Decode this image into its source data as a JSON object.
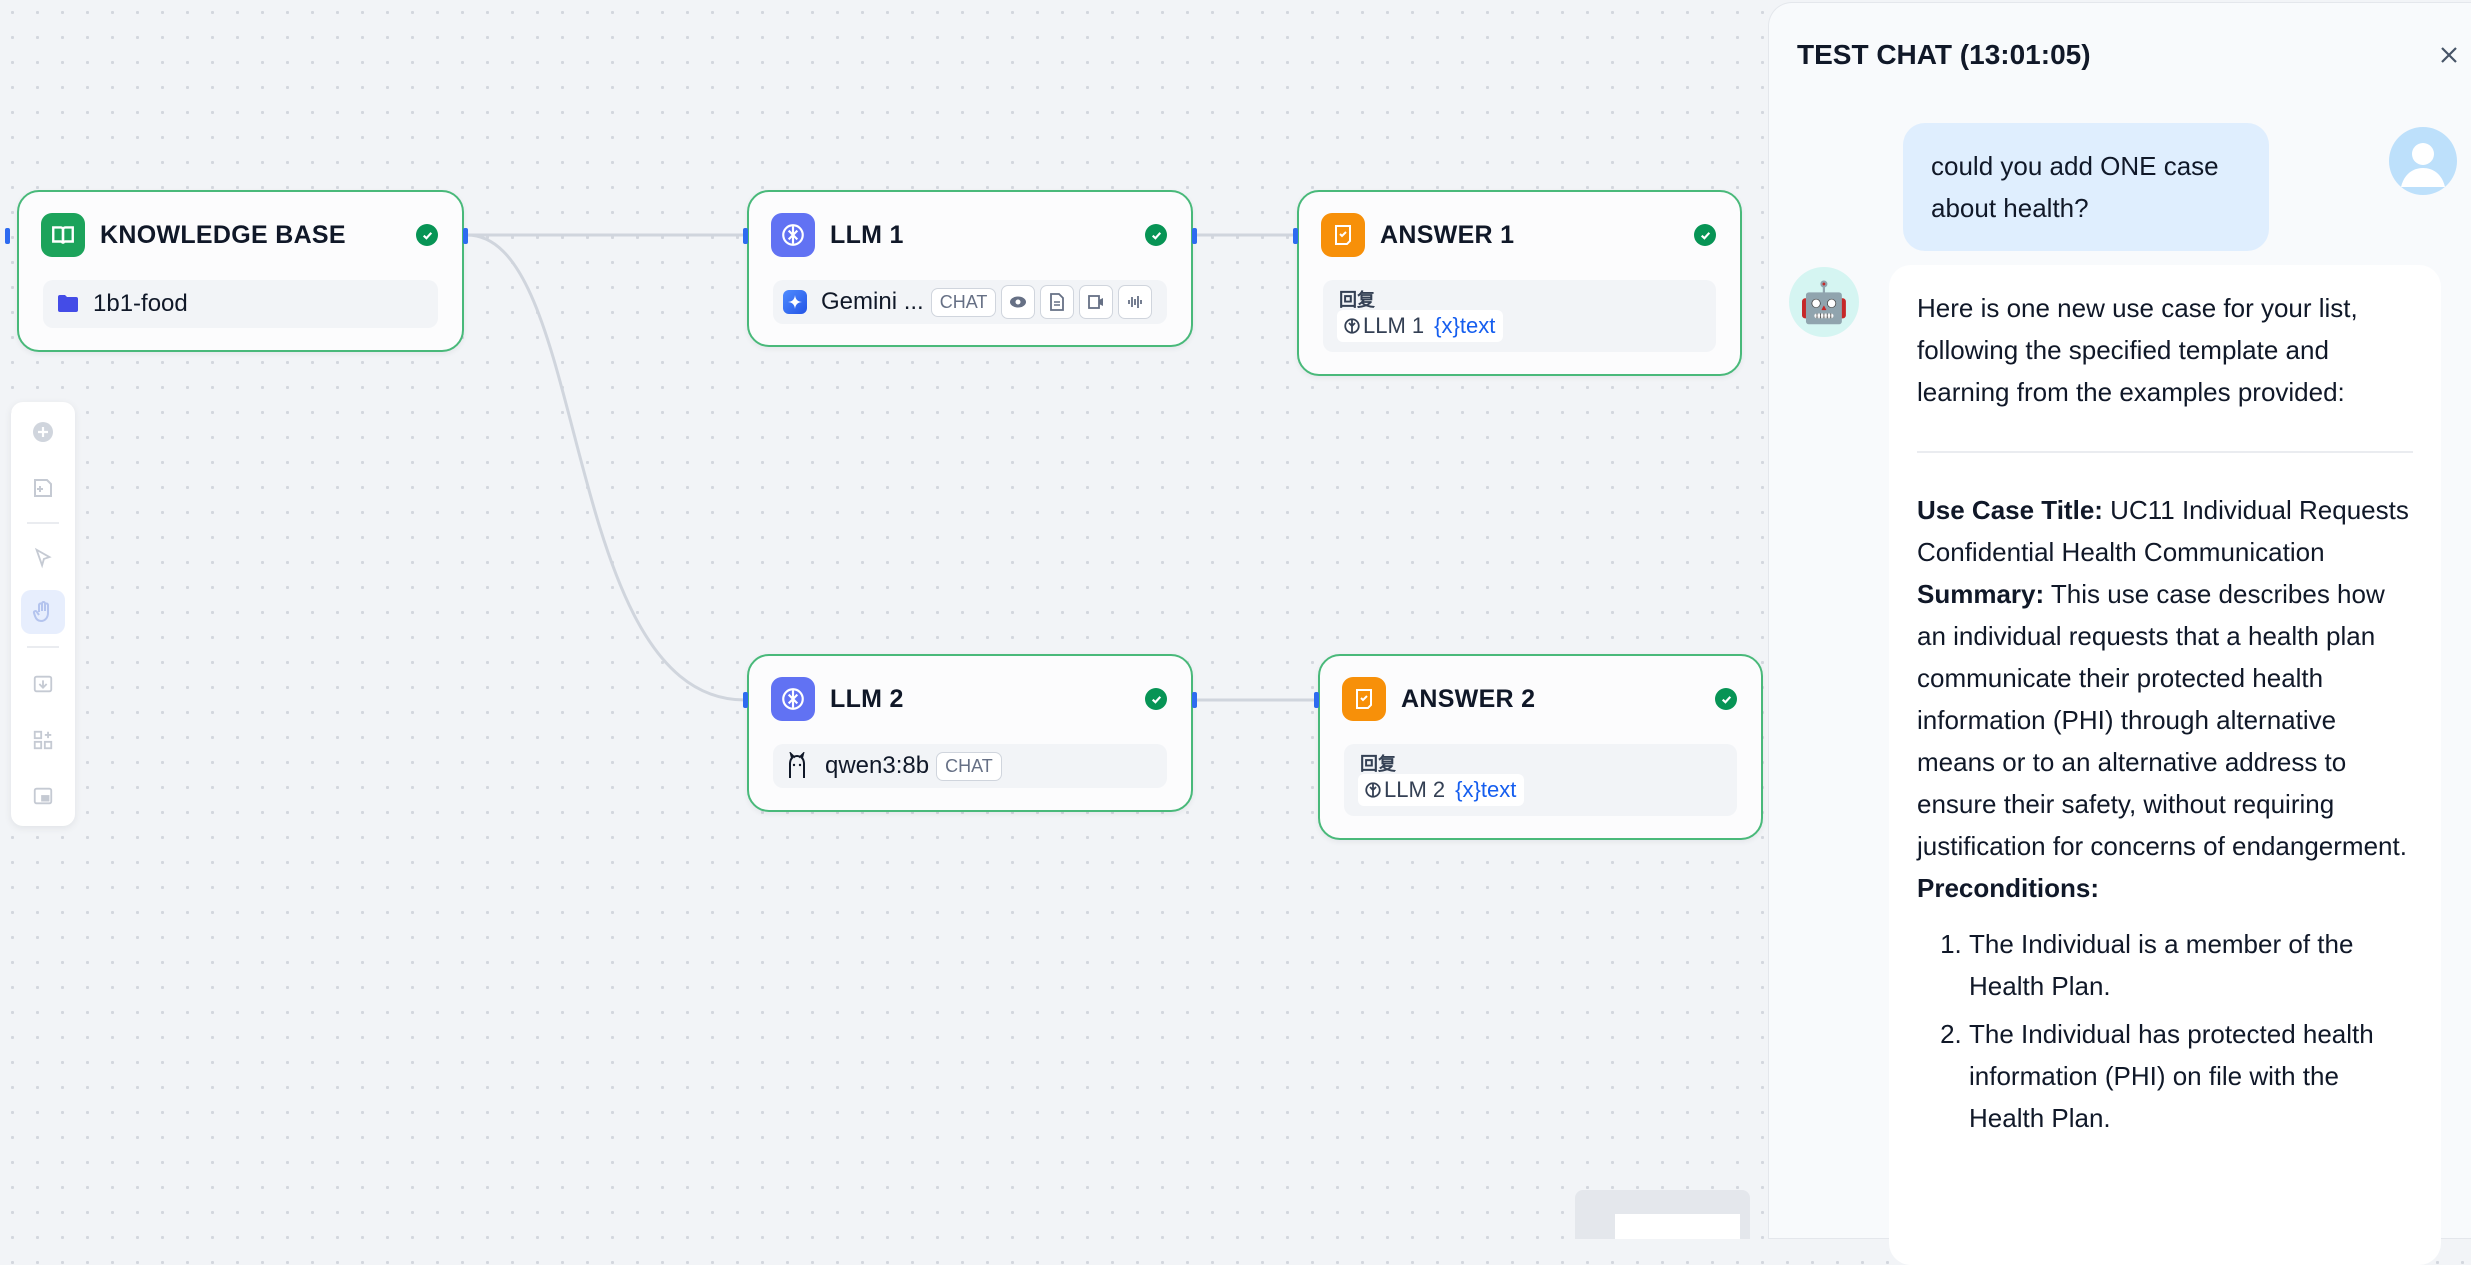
{
  "nodes": {
    "knowledge": {
      "title": "KNOWLEDGE BASE",
      "dataset": "1b1-food"
    },
    "llm1": {
      "title": "LLM 1",
      "model": "Gemini ...",
      "mode": "CHAT"
    },
    "llm2": {
      "title": "LLM 2",
      "model": "qwen3:8b",
      "mode": "CHAT"
    },
    "answer1": {
      "title": "ANSWER 1",
      "label": "回复",
      "ref_node": "LLM 1",
      "ref_var": "{x}text"
    },
    "answer2": {
      "title": "ANSWER 2",
      "label": "回复",
      "ref_node": "LLM 2",
      "ref_var": "{x}text"
    }
  },
  "toolbar": {
    "items": [
      "add-node-icon",
      "add-note-icon",
      "pointer-icon",
      "hand-icon",
      "export-image-icon",
      "organize-icon",
      "minimap-icon"
    ],
    "active": "hand-icon"
  },
  "chat": {
    "title": "TEST CHAT (13:01:05)",
    "user_message": "could you add ONE case about health?",
    "bot": {
      "intro": "Here is one new use case for your list, following the specified template and learning from the examples provided:",
      "title_label": "Use Case Title:",
      "title_value": "UC11 Individual Requests Confidential Health Communication",
      "summary_label": "Summary:",
      "summary_value": "This use case describes how an individual requests that a health plan communicate their protected health information (PHI) through alternative means or to an alternative address to ensure their safety, without requiring justification for concerns of endangerment.",
      "preconditions_label": "Preconditions:",
      "preconditions": [
        "The Individual is a member of the Health Plan.",
        "The Individual has protected health information (PHI) on file with the Health Plan."
      ]
    }
  },
  "colors": {
    "success": "#079455",
    "kb_icon": "#1ca35b",
    "llm_icon": "#6172f3",
    "answer_icon": "#f79009",
    "edge": "#d0d5dd",
    "port": "#2e6bf0"
  }
}
